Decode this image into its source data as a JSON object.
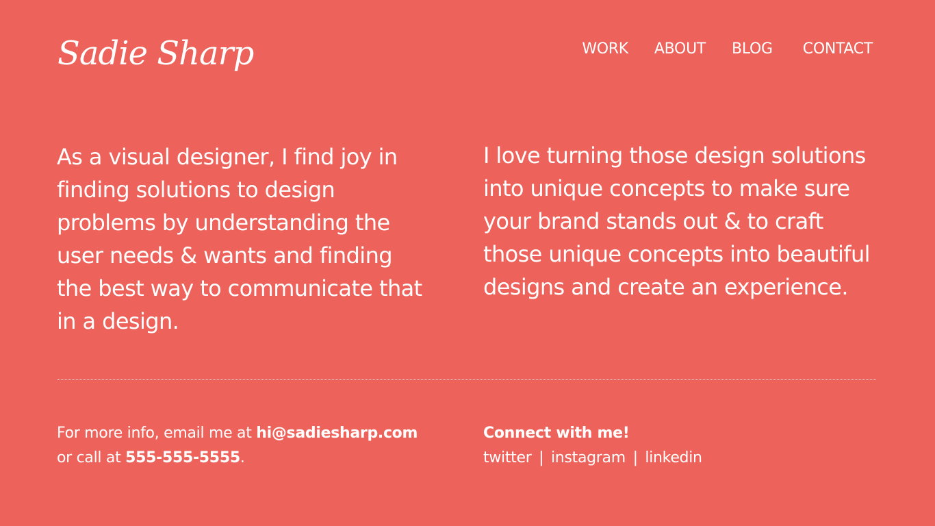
{
  "header": {
    "logo_text": "Sadie Sharp",
    "nav": [
      {
        "label": "WORK"
      },
      {
        "label": "ABOUT"
      },
      {
        "label": "BLOG"
      },
      {
        "label": "CONTACT"
      }
    ]
  },
  "main": {
    "left_text": "As a visual designer, I find joy in finding solutions to design problems by understanding the user needs & wants and finding the best way to communicate that in a design.",
    "right_text": "I love turning those design solutions into unique concepts to make sure your brand stands out & to craft those unique concepts into beautiful designs and create an experience."
  },
  "footer": {
    "info_prefix": "For more info, email me at ",
    "email": "hi@sadiesharp.com",
    "call_prefix": "or call at ",
    "phone": "555-555-5555",
    "call_suffix": ".",
    "connect_heading": "Connect with me!",
    "social": [
      {
        "label": "twitter"
      },
      {
        "label": "instagram"
      },
      {
        "label": "linkedin"
      }
    ],
    "separator": "|"
  },
  "colors": {
    "background": "#ed625a",
    "text": "#ffffff"
  }
}
